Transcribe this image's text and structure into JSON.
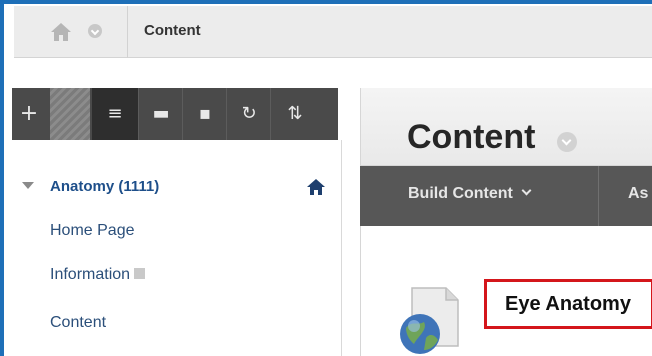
{
  "breadcrumb": {
    "home_icon": "home-icon",
    "menu_icon": "chevron-down-icon",
    "current": "Content"
  },
  "toolbar": {
    "buttons": [
      {
        "icon": "plus-icon",
        "glyph": "+"
      },
      {
        "icon": "list-icon",
        "glyph": "≡"
      },
      {
        "icon": "folder-icon",
        "glyph": "▬"
      },
      {
        "icon": "window-icon",
        "glyph": "▪"
      },
      {
        "icon": "refresh-icon",
        "glyph": "↻"
      },
      {
        "icon": "sort-icon",
        "glyph": "⇅"
      }
    ]
  },
  "course_menu": {
    "title": "Anatomy (1111)",
    "items": [
      {
        "label": "Home Page"
      },
      {
        "label": "Information"
      },
      {
        "label": "Content"
      }
    ]
  },
  "main": {
    "title": "Content",
    "actions": {
      "build_content": "Build Content",
      "assessments": "As"
    },
    "item": {
      "title": "Eye Anatomy"
    }
  },
  "colors": {
    "frame_blue": "#1e6fb8",
    "link_blue": "#1e4f8a",
    "highlight_red": "#d4161b",
    "toolbar_dark": "#4a4a4a"
  }
}
